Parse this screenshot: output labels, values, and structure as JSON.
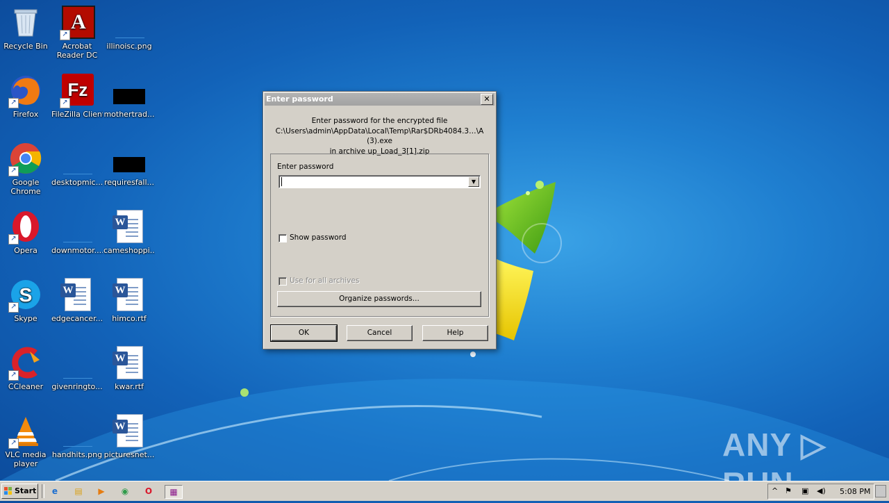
{
  "desktop": {
    "icons": [
      {
        "label": "Recycle Bin",
        "icon": "recycle-bin-icon"
      },
      {
        "label": "Acrobat Reader DC",
        "label1": "Acrobat",
        "label2": "Reader DC",
        "icon": "acrobat-icon"
      },
      {
        "label": "illinoisc.png",
        "icon": "image-file-icon"
      },
      {
        "label": "Firefox",
        "icon": "firefox-icon"
      },
      {
        "label": "FileZilla Client",
        "icon": "filezilla-icon"
      },
      {
        "label": "mothertrad...",
        "icon": "black-file-icon"
      },
      {
        "label": "Google Chrome",
        "label1": "Google",
        "label2": "Chrome",
        "icon": "chrome-icon"
      },
      {
        "label": "desktopmic...",
        "icon": "image-file-icon"
      },
      {
        "label": "requiresfall...",
        "icon": "black-file-icon"
      },
      {
        "label": "Opera",
        "icon": "opera-icon"
      },
      {
        "label": "downmotor....",
        "icon": "image-file-icon"
      },
      {
        "label": "cameshoppi...",
        "icon": "word-doc-icon"
      },
      {
        "label": "Skype",
        "icon": "skype-icon"
      },
      {
        "label": "edgecancer....",
        "icon": "word-doc-icon"
      },
      {
        "label": "himco.rtf",
        "icon": "word-doc-icon"
      },
      {
        "label": "CCleaner",
        "icon": "ccleaner-icon"
      },
      {
        "label": "givenringto...",
        "icon": "image-file-icon"
      },
      {
        "label": "kwar.rtf",
        "icon": "word-doc-icon"
      },
      {
        "label": "VLC media player",
        "label1": "VLC media",
        "label2": "player",
        "icon": "vlc-icon"
      },
      {
        "label": "handhits.png",
        "icon": "image-file-icon"
      },
      {
        "label": "picturesnet...",
        "icon": "word-doc-icon"
      }
    ],
    "shortcut_arrow": "↗",
    "acrobat_glyph": "A",
    "filezilla_glyph": "Fz",
    "opera_glyph": "O",
    "skype_glyph": "S",
    "word_glyph": "W"
  },
  "dialog": {
    "title": "Enter password",
    "close_glyph": "✕",
    "message": [
      "Enter password for the encrypted file",
      "C:\\Users\\admin\\AppData\\Local\\Temp\\Rar$DRb4084.3…\\A (3).exe",
      "in archive up_Load_3[1].zip"
    ],
    "password_label": "Enter password",
    "password_value": "",
    "dropdown_glyph": "▼",
    "show_password_label": "Show password",
    "show_password_checked": false,
    "use_for_all_label": "Use for all archives",
    "use_for_all_enabled": false,
    "organize_label": "Organize passwords...",
    "ok_label": "OK",
    "cancel_label": "Cancel",
    "help_label": "Help"
  },
  "watermark": "ANY ▷ RUN",
  "taskbar": {
    "start_label": "Start",
    "quicklaunch": [
      {
        "name": "ie-icon",
        "glyph": "e"
      },
      {
        "name": "explorer-folder-icon",
        "glyph": "▤"
      },
      {
        "name": "media-player-icon",
        "glyph": "▶"
      },
      {
        "name": "chrome-icon",
        "glyph": "◉"
      },
      {
        "name": "opera-icon",
        "glyph": "O"
      },
      {
        "name": "winrar-icon",
        "glyph": "▦"
      }
    ],
    "tray": {
      "expand_glyph": "^",
      "flag_glyph": "⚑",
      "network_glyph": "▣",
      "volume_glyph": "◀)",
      "clock": "5:08 PM"
    }
  },
  "colors": {
    "wallpaper": "#1f7fd0",
    "dialog_face": "#d4d0c8",
    "titlebar_inactive": "#a8a8a8"
  }
}
